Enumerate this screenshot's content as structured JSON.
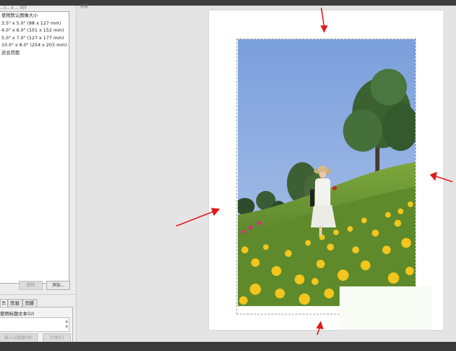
{
  "left_panel": {
    "cut_label": "...)... x ... 0)?",
    "print_sizes": [
      "使用默认图像大小",
      "3.5\" x 5.0\" (88 x 127 mm)",
      "4.0\" x 6.0\" (101 x 152 mm)",
      "5.0\" x 7.0\" (127 x 177 mm)",
      "10.0\" x 8.0\" (254 x 203 mm)",
      "适合页面"
    ],
    "delete_button": "删除",
    "add_button": "添加...",
    "tabs": [
      "页",
      "页眉",
      "页脚"
    ],
    "use_title_checkbox": "使用标题文本(U)",
    "insert_button": "插入元数据(M)",
    "font_button": "字体(F)"
  },
  "preview": {
    "label": "预览"
  },
  "colors": {
    "arrow": "#e01a1a",
    "sky": "#7fa2dd",
    "flowers": "#f3c21b"
  }
}
